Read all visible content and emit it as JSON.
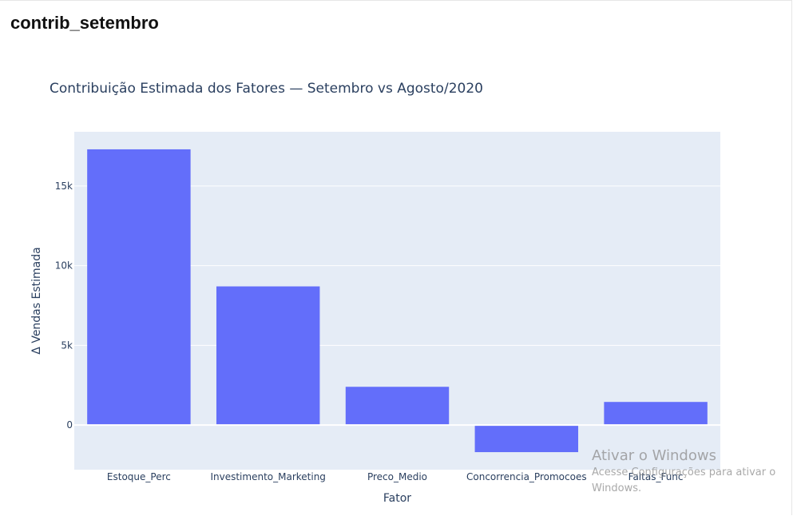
{
  "page": {
    "heading": "contrib_setembro"
  },
  "watermark": {
    "title": "Ativar o Windows",
    "body": "Acesse Configurações para ativar o Windows."
  },
  "chart_data": {
    "type": "bar",
    "title": "Contribuição Estimada dos Fatores — Setembro vs Agosto/2020",
    "xlabel": "Fator",
    "ylabel": "Δ Vendas Estimada",
    "categories": [
      "Estoque_Perc",
      "Investimento_Marketing",
      "Preco_Medio",
      "Concorrencia_Promocoes",
      "Faltas_Func"
    ],
    "values": [
      17300,
      8700,
      2400,
      -1700,
      1450
    ],
    "ylim": [
      -2800,
      18400
    ],
    "yticks": [
      0,
      5000,
      10000,
      15000
    ],
    "ytick_labels": [
      "0",
      "5k",
      "10k",
      "15k"
    ],
    "grid": true,
    "colors": {
      "bar": "#636efa",
      "plot_bg": "#e5ecf6",
      "grid": "#ffffff",
      "text": "#2a3f5f"
    }
  }
}
